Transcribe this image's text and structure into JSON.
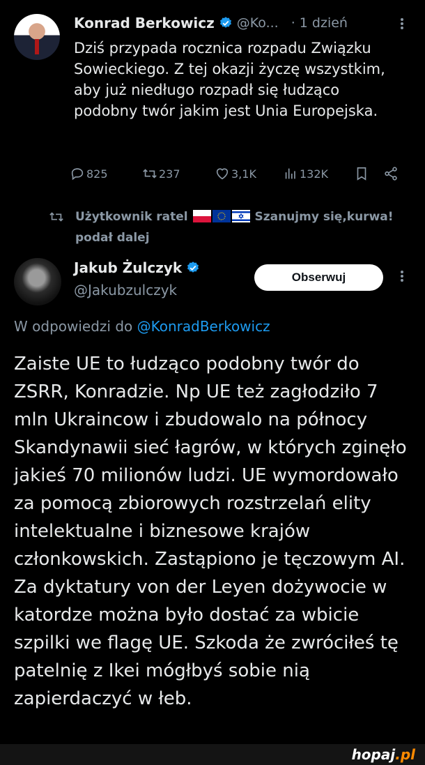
{
  "tweet1": {
    "author_name": "Konrad Berkowicz",
    "author_handle": "@Ko...",
    "time": "· 1 dzień",
    "text": "Dziś przypada rocznica rozpadu Związku Sowieckiego. Z tej okazji życzę wszystkim, aby już niedługo rozpadł się łudząco podobny twór jakim jest Unia Europejska.",
    "stats": {
      "replies": "825",
      "retweets": "237",
      "likes": "3,1K",
      "views": "132K"
    }
  },
  "retweet_notice": {
    "line1_start": "Użytkownik ratel",
    "line1_end": "Szanujmy się,kurwa!",
    "line2": "podał dalej"
  },
  "tweet2": {
    "author_name": "Jakub Żulczyk",
    "author_handle": "@Jakubzulczyk",
    "follow_label": "Obserwuj",
    "reply_prefix": "W odpowiedzi do",
    "reply_to": "@KonradBerkowicz",
    "text": "Zaiste UE to łudząco podobny twór do ZSRR, Konradzie. Np UE też zagłodziło 7 mln Ukraincow i zbudowalo na północy Skandynawii sieć łagrów, w których zginęło jakieś 70 milionów ludzi. UE wymordowało za pomocą zbiorowych rozstrzelań elity intelektualne i biznesowe krajów członkowskich. Zastąpiono je tęczowym AI. Za dyktatury von der Leyen dożywocie w katordze można było dostać za wbicie szpilki we flagę UE. Szkoda że zwróciłeś tę patelnię z Ikei mógłbyś sobie nią zapierdaczyć w łeb."
  },
  "watermark": {
    "main": "hopaj",
    "suffix": ".pl"
  },
  "colors": {
    "background": "#000000",
    "text": "#e7e9ea",
    "muted": "#8b98a5",
    "link": "#1d9bf0",
    "verified": "#1d9bf0"
  },
  "icons": [
    "verified-badge-icon",
    "more-options-icon",
    "reply-icon",
    "retweet-icon",
    "like-icon",
    "views-icon",
    "bookmark-icon",
    "share-icon",
    "poland-flag-icon",
    "eu-flag-icon",
    "israel-flag-icon"
  ]
}
